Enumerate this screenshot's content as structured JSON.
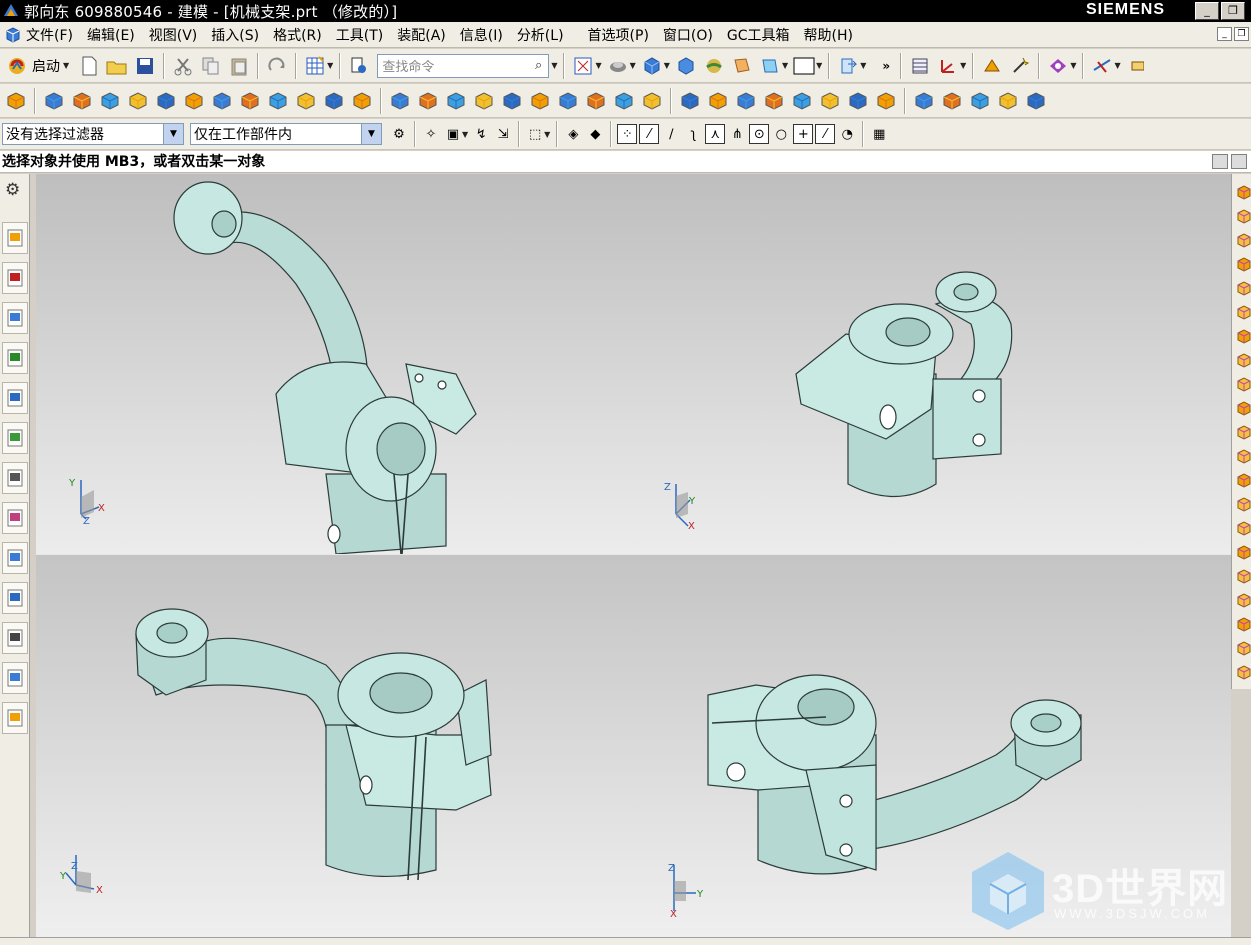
{
  "window": {
    "title": "郭向东 609880546 - 建模 - [机械支架.prt （修改的）]",
    "brand": "SIEMENS",
    "buttons": {
      "minimize": "_",
      "restore": "❐"
    }
  },
  "menu": {
    "items": [
      "文件(F)",
      "编辑(E)",
      "视图(V)",
      "插入(S)",
      "格式(R)",
      "工具(T)",
      "装配(A)",
      "信息(I)",
      "分析(L)",
      "首选项(P)",
      "窗口(O)",
      "GC工具箱",
      "帮助(H)"
    ]
  },
  "toolbar": {
    "start_label": "启动",
    "search_placeholder": "查找命令",
    "overflow": "»"
  },
  "selection_bar": {
    "type_filter": "没有选择过滤器",
    "scope_filter": "仅在工作部件内"
  },
  "cue_line": {
    "text": "选择对象并使用 MB3，或者双击某一对象"
  },
  "viewports": [
    {
      "id": "top-left",
      "triad": {
        "x": "X",
        "y": "Y",
        "z": "Z"
      }
    },
    {
      "id": "top-right",
      "triad": {
        "x": "X",
        "y": "Y",
        "z": "Z"
      }
    },
    {
      "id": "bottom-left",
      "triad": {
        "x": "X",
        "y": "Y",
        "z": "Z"
      }
    },
    {
      "id": "bottom-right",
      "triad": {
        "x": "X",
        "y": "Y",
        "z": "Z"
      }
    }
  ],
  "colors": {
    "part_face": "#c7e8e2",
    "part_edge": "#2c3b38",
    "accent_blue": "#3a7bd5",
    "accent_orange": "#f0a000"
  },
  "watermark": {
    "text": "3D世界网",
    "sub": "WWW.3DSJW.COM"
  }
}
